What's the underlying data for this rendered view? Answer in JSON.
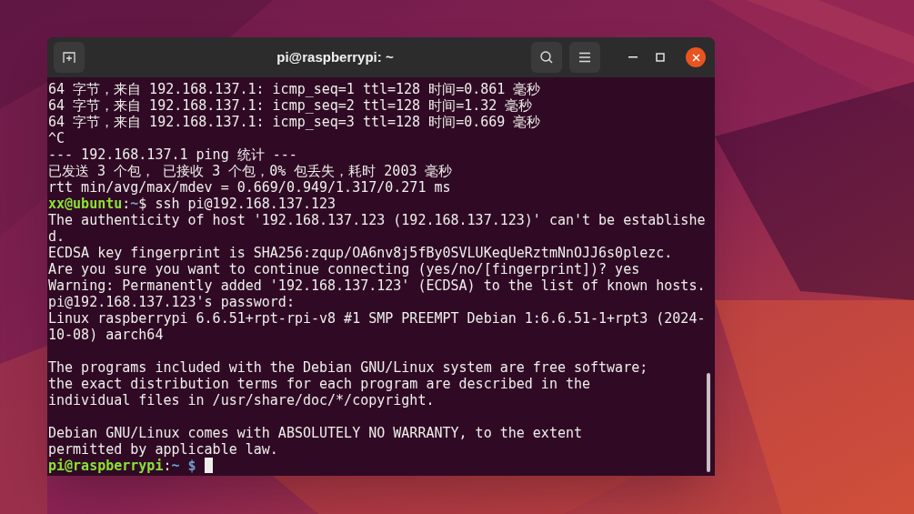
{
  "window": {
    "title": "pi@raspberrypi: ~"
  },
  "terminal": {
    "lines": [
      {
        "kind": "output",
        "text": "64 字节，来自 192.168.137.1: icmp_seq=1 ttl=128 时间=0.861 毫秒"
      },
      {
        "kind": "output",
        "text": "64 字节，来自 192.168.137.1: icmp_seq=2 ttl=128 时间=1.32 毫秒"
      },
      {
        "kind": "output",
        "text": "64 字节，来自 192.168.137.1: icmp_seq=3 ttl=128 时间=0.669 毫秒"
      },
      {
        "kind": "output",
        "text": "^C"
      },
      {
        "kind": "output",
        "text": "--- 192.168.137.1 ping 统计 ---"
      },
      {
        "kind": "output",
        "text": "已发送 3 个包， 已接收 3 个包，0% 包丢失，耗时 2003 毫秒"
      },
      {
        "kind": "output",
        "text": "rtt min/avg/max/mdev = 0.669/0.949/1.317/0.271 ms"
      },
      {
        "kind": "prompt",
        "cursor": false,
        "segments": [
          {
            "text": "xx@ubuntu",
            "kind": "user"
          },
          {
            "text": ":",
            "kind": "plain"
          },
          {
            "text": "~",
            "kind": "path"
          },
          {
            "text": "$ ssh pi@192.168.137.123",
            "kind": "plain"
          }
        ]
      },
      {
        "kind": "output",
        "text": "The authenticity of host '192.168.137.123 (192.168.137.123)' can't be establishe"
      },
      {
        "kind": "output",
        "text": "d."
      },
      {
        "kind": "output",
        "text": "ECDSA key fingerprint is SHA256:zqup/OA6nv8j5fBy0SVLUKeqUeRztmNnOJJ6s0plezc."
      },
      {
        "kind": "output",
        "text": "Are you sure you want to continue connecting (yes/no/[fingerprint])? yes"
      },
      {
        "kind": "output",
        "text": "Warning: Permanently added '192.168.137.123' (ECDSA) to the list of known hosts."
      },
      {
        "kind": "output",
        "text": "pi@192.168.137.123's password:"
      },
      {
        "kind": "output",
        "text": "Linux raspberrypi 6.6.51+rpt-rpi-v8 #1 SMP PREEMPT Debian 1:6.6.51-1+rpt3 (2024-"
      },
      {
        "kind": "output",
        "text": "10-08) aarch64"
      },
      {
        "kind": "blank"
      },
      {
        "kind": "output",
        "text": "The programs included with the Debian GNU/Linux system are free software;"
      },
      {
        "kind": "output",
        "text": "the exact distribution terms for each program are described in the"
      },
      {
        "kind": "output",
        "text": "individual files in /usr/share/doc/*/copyright."
      },
      {
        "kind": "blank"
      },
      {
        "kind": "output",
        "text": "Debian GNU/Linux comes with ABSOLUTELY NO WARRANTY, to the extent"
      },
      {
        "kind": "output",
        "text": "permitted by applicable law."
      },
      {
        "kind": "prompt",
        "cursor": true,
        "segments": [
          {
            "text": "pi@raspberrypi",
            "kind": "user"
          },
          {
            "text": ":",
            "kind": "plain"
          },
          {
            "text": "~ $",
            "kind": "path"
          }
        ]
      }
    ]
  }
}
